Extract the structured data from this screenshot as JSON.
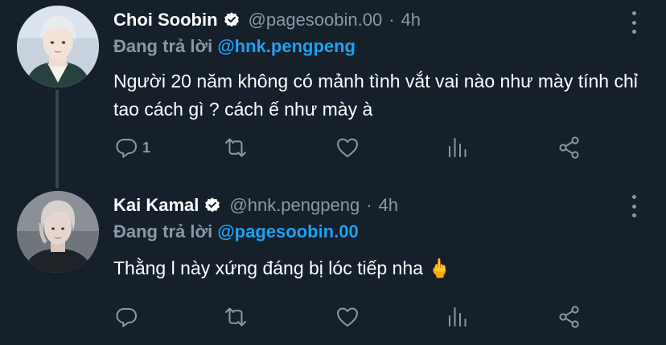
{
  "tweets": [
    {
      "name": "Choi Soobin",
      "handle": "@pagesoobin.00",
      "time": "4h",
      "reply_label": "Đang trả lời",
      "reply_to": "@hnk.pengpeng",
      "text": "Người 20 năm không có mảnh tình vắt vai nào như mày tính chỉ tao cách gì ? cách ế như mày à",
      "reply_count": "1"
    },
    {
      "name": "Kai Kamal",
      "handle": "@hnk.pengpeng",
      "time": "4h",
      "reply_label": "Đang trả lời",
      "reply_to": "@pagesoobin.00",
      "text": "Thằng l này xứng đáng bị lóc tiếp nha 🖕",
      "reply_count": ""
    }
  ],
  "separator": "·",
  "colors": {
    "background": "#15202b",
    "secondary_text": "#8899a6",
    "link": "#1da1f2",
    "thread_line": "#38444d"
  },
  "icons": [
    "reply-icon",
    "retweet-icon",
    "like-icon",
    "analytics-icon",
    "share-icon",
    "more-icon",
    "verified-badge-icon"
  ]
}
